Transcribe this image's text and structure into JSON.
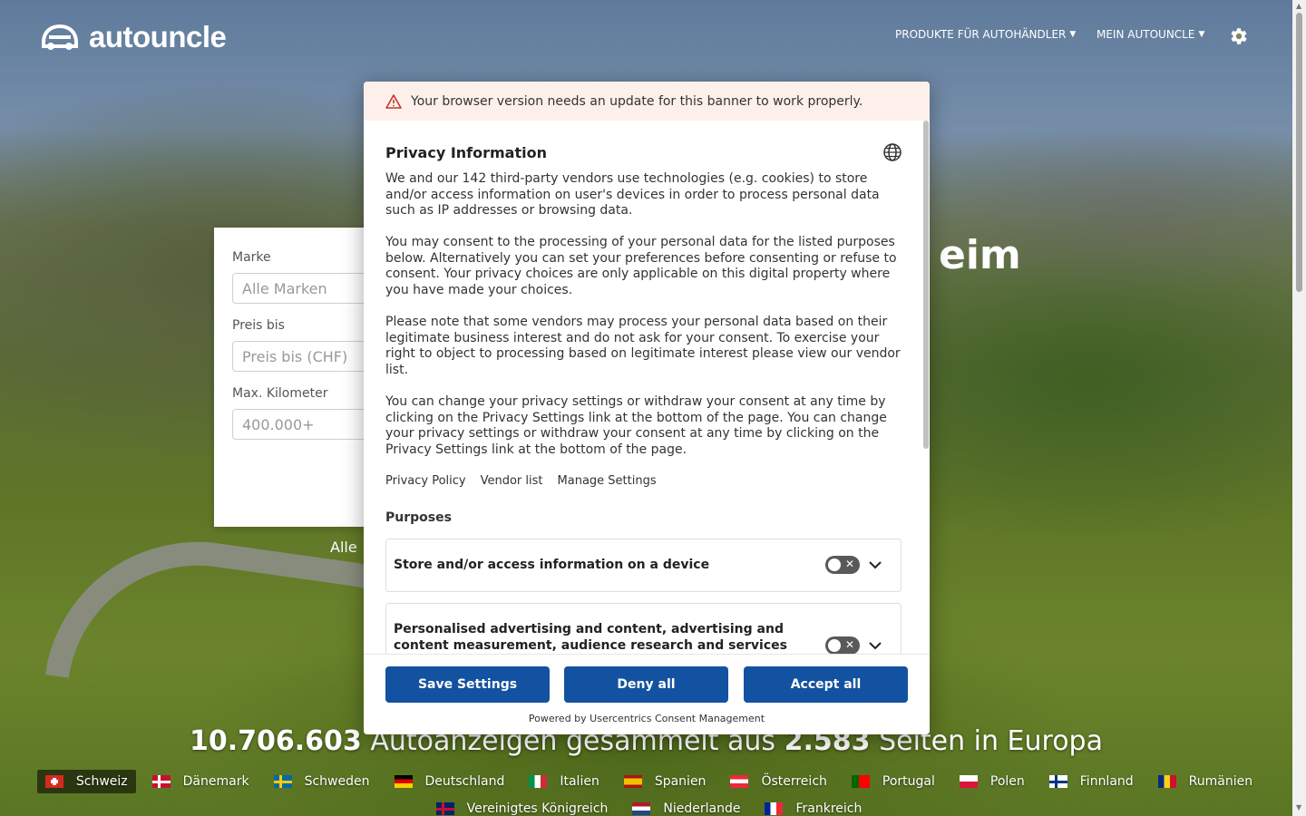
{
  "brand": {
    "name": "autouncle"
  },
  "nav": {
    "items": [
      {
        "label": "PRODUKTE FÜR AUTOHÄNDLER"
      },
      {
        "label": "MEIN AUTOUNCLE"
      }
    ]
  },
  "search": {
    "fields": [
      {
        "label": "Marke",
        "placeholder": "Alle Marken"
      },
      {
        "label": "Preis bis",
        "placeholder": "Preis bis (CHF)"
      },
      {
        "label": "Max. Kilometer",
        "placeholder": "400.000+"
      }
    ],
    "all_link_partial": "Alle"
  },
  "hero": {
    "title_partial": "eim"
  },
  "stats": {
    "listings": "10.706.603",
    "listings_text": "Autoanzeigen gesammelt aus",
    "sites": "2.583",
    "sites_text": "Seiten in Europa"
  },
  "countries": [
    {
      "label": "Schweiz",
      "flag": "ch",
      "active": true
    },
    {
      "label": "Dänemark",
      "flag": "dk"
    },
    {
      "label": "Schweden",
      "flag": "se"
    },
    {
      "label": "Deutschland",
      "flag": "de"
    },
    {
      "label": "Italien",
      "flag": "it"
    },
    {
      "label": "Spanien",
      "flag": "es"
    },
    {
      "label": "Österreich",
      "flag": "at"
    },
    {
      "label": "Portugal",
      "flag": "pt"
    },
    {
      "label": "Polen",
      "flag": "pl"
    },
    {
      "label": "Finnland",
      "flag": "fi"
    },
    {
      "label": "Rumänien",
      "flag": "ro"
    },
    {
      "label": "Vereinigtes Königreich",
      "flag": "gb"
    },
    {
      "label": "Niederlande",
      "flag": "nl"
    },
    {
      "label": "Frankreich",
      "flag": "fr"
    }
  ],
  "consent": {
    "warning": "Your browser version needs an update for this banner to work properly.",
    "title": "Privacy Information",
    "paragraphs": [
      "We and our 142 third-party vendors use technologies (e.g. cookies) to store and/or access information on user's devices in order to process personal data such as IP addresses or browsing data.",
      "You may consent to the processing of your personal data for the listed purposes below. Alternatively you can set your preferences before consenting or refuse to consent. Your privacy choices are only applicable on this digital property where you have made your choices.",
      "Please note that some vendors may process your personal data based on their legitimate business interest and do not ask for your consent. To exercise your right to object to processing based on legitimate interest please view our vendor list.",
      "You can change your privacy settings or withdraw your consent at any time by clicking on the Privacy Settings link at the bottom of the page. You can change your privacy settings or withdraw your consent at any time by clicking on the Privacy Settings link at the bottom of the page."
    ],
    "links": [
      "Privacy Policy",
      "Vendor list",
      "Manage Settings"
    ],
    "purposes_heading": "Purposes",
    "purposes": [
      {
        "label": "Store and/or access information on a device",
        "enabled": false
      },
      {
        "label": "Personalised advertising and content, advertising and content measurement, audience research and services",
        "enabled": false
      }
    ],
    "buttons": {
      "save": "Save Settings",
      "deny": "Deny all",
      "accept": "Accept all"
    },
    "powered_by": "Powered by Usercentrics Consent Management"
  },
  "colors": {
    "primary_button": "#1352a0",
    "warning_bg": "#fdf0ea",
    "toggle_off": "#595959"
  }
}
